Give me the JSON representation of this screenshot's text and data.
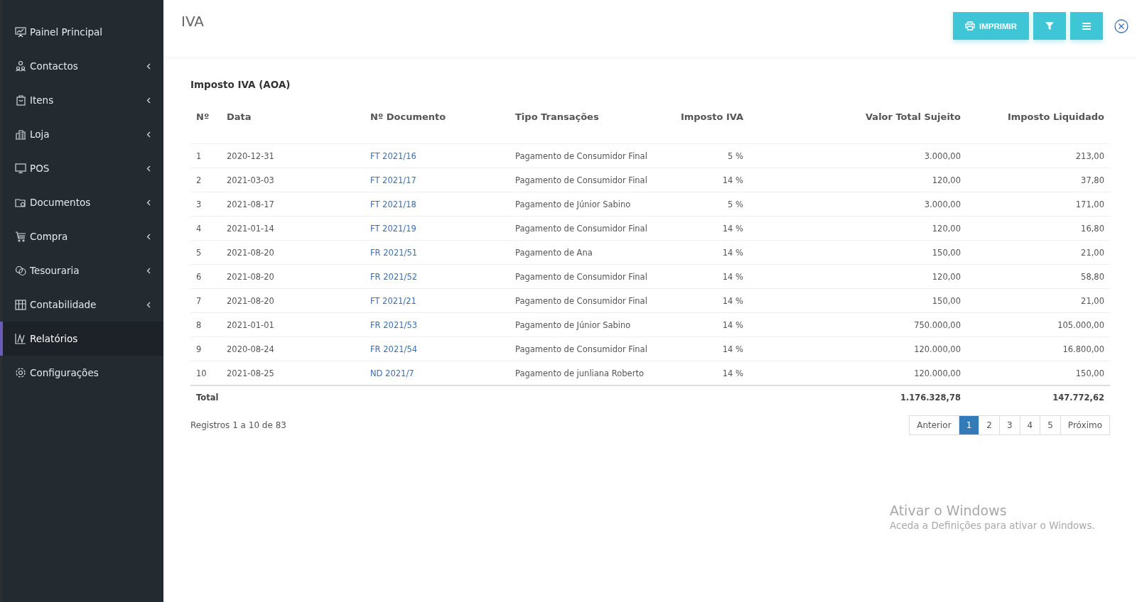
{
  "sidebar": {
    "items": [
      {
        "label": "Painel Principal",
        "has_submenu": false,
        "selected": false
      },
      {
        "label": "Contactos",
        "has_submenu": true,
        "selected": false
      },
      {
        "label": "Itens",
        "has_submenu": true,
        "selected": false
      },
      {
        "label": "Loja",
        "has_submenu": true,
        "selected": false
      },
      {
        "label": "POS",
        "has_submenu": true,
        "selected": false
      },
      {
        "label": "Documentos",
        "has_submenu": true,
        "selected": false
      },
      {
        "label": "Compra",
        "has_submenu": true,
        "selected": false
      },
      {
        "label": "Tesouraria",
        "has_submenu": true,
        "selected": false
      },
      {
        "label": "Contabilidade",
        "has_submenu": true,
        "selected": false
      },
      {
        "label": "Relatórios",
        "has_submenu": false,
        "selected": true
      },
      {
        "label": "Configurações",
        "has_submenu": false,
        "selected": false
      }
    ]
  },
  "header": {
    "title": "IVA",
    "print_button": "IMPRIMIR"
  },
  "report": {
    "title": "Imposto IVA (AOA)",
    "columns": [
      "Nº",
      "Data",
      "Nº Documento",
      "Tipo Transações",
      "Imposto IVA",
      "Valor Total Sujeito",
      "Imposto Liquidado"
    ],
    "rows": [
      [
        "1",
        "2020-12-31",
        "FT 2021/16",
        "Pagamento de Consumidor Final",
        "5 %",
        "3.000,00",
        "213,00"
      ],
      [
        "2",
        "2021-03-03",
        "FT 2021/17",
        "Pagamento de Consumidor Final",
        "14 %",
        "120,00",
        "37,80"
      ],
      [
        "3",
        "2021-08-17",
        "FT 2021/18",
        "Pagamento de Júnior Sabino",
        "5 %",
        "3.000,00",
        "171,00"
      ],
      [
        "4",
        "2021-01-14",
        "FT 2021/19",
        "Pagamento de Consumidor Final",
        "14 %",
        "120,00",
        "16,80"
      ],
      [
        "5",
        "2021-08-20",
        "FR 2021/51",
        "Pagamento de Ana",
        "14 %",
        "150,00",
        "21,00"
      ],
      [
        "6",
        "2021-08-20",
        "FR 2021/52",
        "Pagamento de Consumidor Final",
        "14 %",
        "120,00",
        "58,80"
      ],
      [
        "7",
        "2021-08-20",
        "FT 2021/21",
        "Pagamento de Consumidor Final",
        "14 %",
        "150,00",
        "21,00"
      ],
      [
        "8",
        "2021-01-01",
        "FR 2021/53",
        "Pagamento de Júnior Sabino",
        "14 %",
        "750.000,00",
        "105.000,00"
      ],
      [
        "9",
        "2020-08-24",
        "FR 2021/54",
        "Pagamento de Consumidor Final",
        "14 %",
        "120.000,00",
        "16.800,00"
      ],
      [
        "10",
        "2021-08-25",
        "ND 2021/7",
        "Pagamento de junliana Roberto",
        "14 %",
        "120.000,00",
        "150,00"
      ]
    ],
    "total": {
      "label": "Total",
      "valor_total": "1.176.328,78",
      "imposto_total": "147.772,62"
    },
    "records_info": "Registros 1 a 10 de 83",
    "pagination": {
      "previous": "Anterior",
      "next": "Próximo",
      "pages": [
        {
          "label": "1",
          "selected": true
        },
        {
          "label": "2",
          "selected": false
        },
        {
          "label": "3",
          "selected": false
        },
        {
          "label": "4",
          "selected": false
        },
        {
          "label": "5",
          "selected": false
        }
      ]
    }
  },
  "os_notice": {
    "title": "Ativar o Windows",
    "text": "Aceda a Definições para ativar o Windows."
  }
}
